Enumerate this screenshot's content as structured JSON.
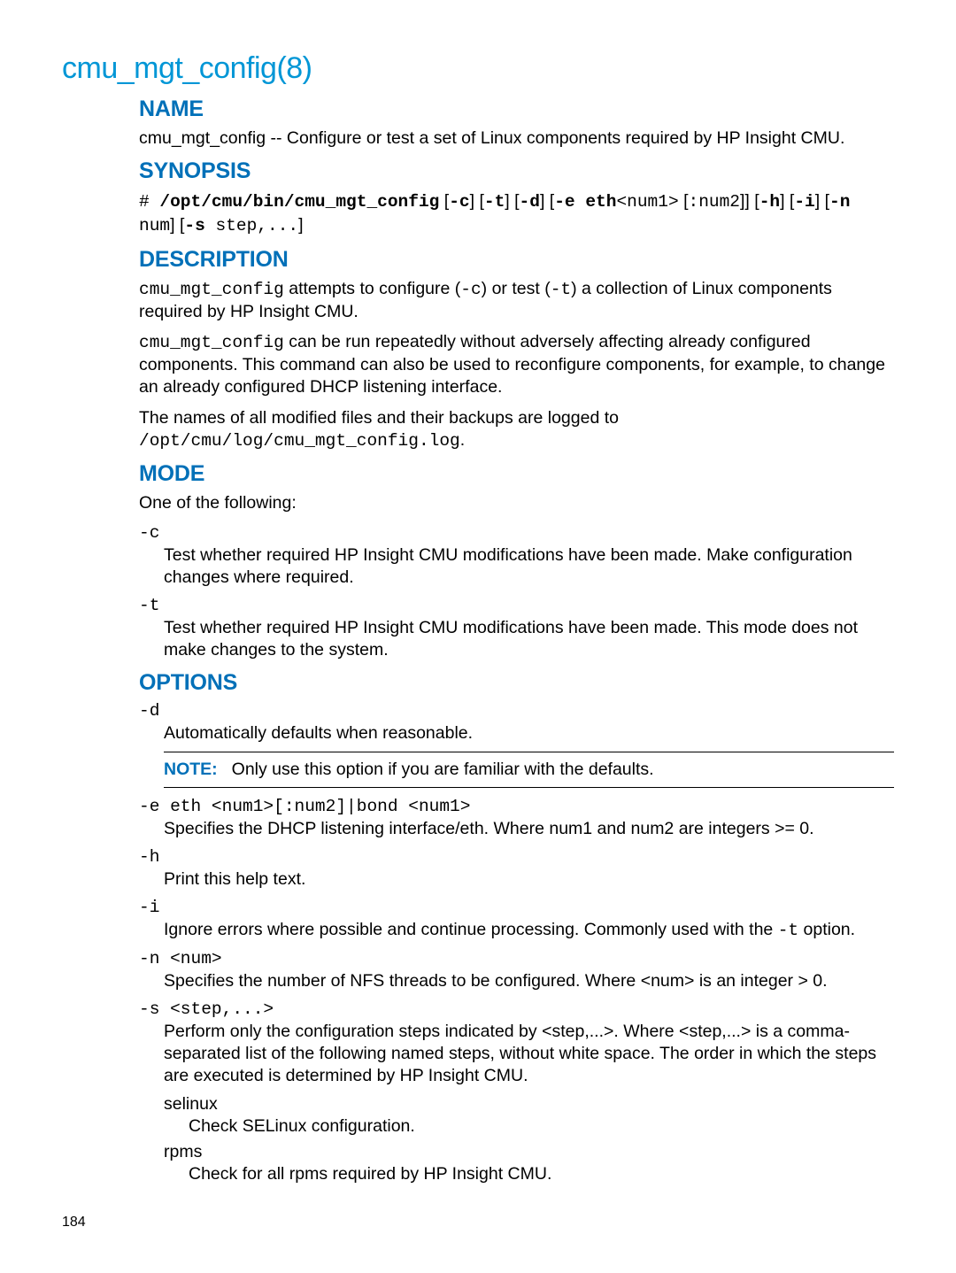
{
  "title": "cmu_mgt_config(8)",
  "pagenum": "184",
  "h": {
    "name": "NAME",
    "synopsis": "SYNOPSIS",
    "description": "DESCRIPTION",
    "mode": "MODE",
    "options": "OPTIONS"
  },
  "name": {
    "cmd": "cmu_mgt_config",
    "desc": " -- Configure or test a set of Linux components required by HP Insight CMU."
  },
  "synopsis": {
    "hash": "# ",
    "cmd": "/opt/cmu/bin/cmu_mgt_config",
    "p1": " [",
    "f_c": "-c",
    "f_t": "-t",
    "f_d": "-d",
    "f_e": "-e eth",
    "e_arg1": "<num1>",
    "e_mid": " [",
    "e_arg2": ":num2",
    "e_end": "]] [",
    "f_h": "-h",
    "f_i": "-i",
    "f_n_start": "-n",
    "n_arg": " num",
    "f_s_start": "-s",
    "s_arg": " step,...",
    "close": "]",
    "sep": "] ["
  },
  "desc": {
    "p1a": "cmu_mgt_config",
    "p1b": " attempts to configure (",
    "p1c": "-c",
    "p1d": ") or test (",
    "p1e": "-t",
    "p1f": ") a collection of Linux components required by HP Insight CMU.",
    "p2a": "cmu_mgt_config",
    "p2b": " can be run repeatedly without adversely affecting already configured components. This command can also be used to reconfigure components, for example, to change an already configured DHCP listening interface.",
    "p3a": "The names of all modified files and their backups are logged to ",
    "p3b": "/opt/cmu/log/cmu_mgt_config.log",
    "p3c": "."
  },
  "mode": {
    "intro": "One of the following:",
    "c_flag": "-c",
    "c_desc": "Test whether required HP Insight CMU modifications have been made. Make configuration changes where required.",
    "t_flag": "-t",
    "t_desc": "Test whether required HP Insight CMU modifications have been made. This mode does not make changes to the system."
  },
  "opts": {
    "d_flag": "-d",
    "d_desc": "Automatically defaults when reasonable.",
    "note_label": "NOTE:",
    "note_text": "Only use this option if you are familiar with the defaults.",
    "e_flag": "-e eth <num1>[:num2]|bond <num1>",
    "e_desc": "Specifies the DHCP listening interface/eth. Where num1 and num2 are integers >= 0.",
    "h_flag": "-h",
    "h_desc": "Print this help text.",
    "i_flag": "-i",
    "i_desc_a": "Ignore errors where possible and continue processing. Commonly used with the ",
    "i_desc_b": "-t",
    "i_desc_c": " option.",
    "n_flag": "-n <num>",
    "n_desc": "Specifies the number of NFS threads to be configured. Where <num> is an integer > 0.",
    "s_flag": "-s <step,...>",
    "s_desc": "Perform only the configuration steps indicated by <step,...>. Where <step,...> is a comma-separated list of the following named steps, without white space. The order in which the steps are executed is determined by HP Insight CMU.",
    "selinux_t": "selinux",
    "selinux_d": "Check SELinux configuration.",
    "rpms_t": "rpms",
    "rpms_d": "Check for all rpms required by HP Insight CMU."
  }
}
